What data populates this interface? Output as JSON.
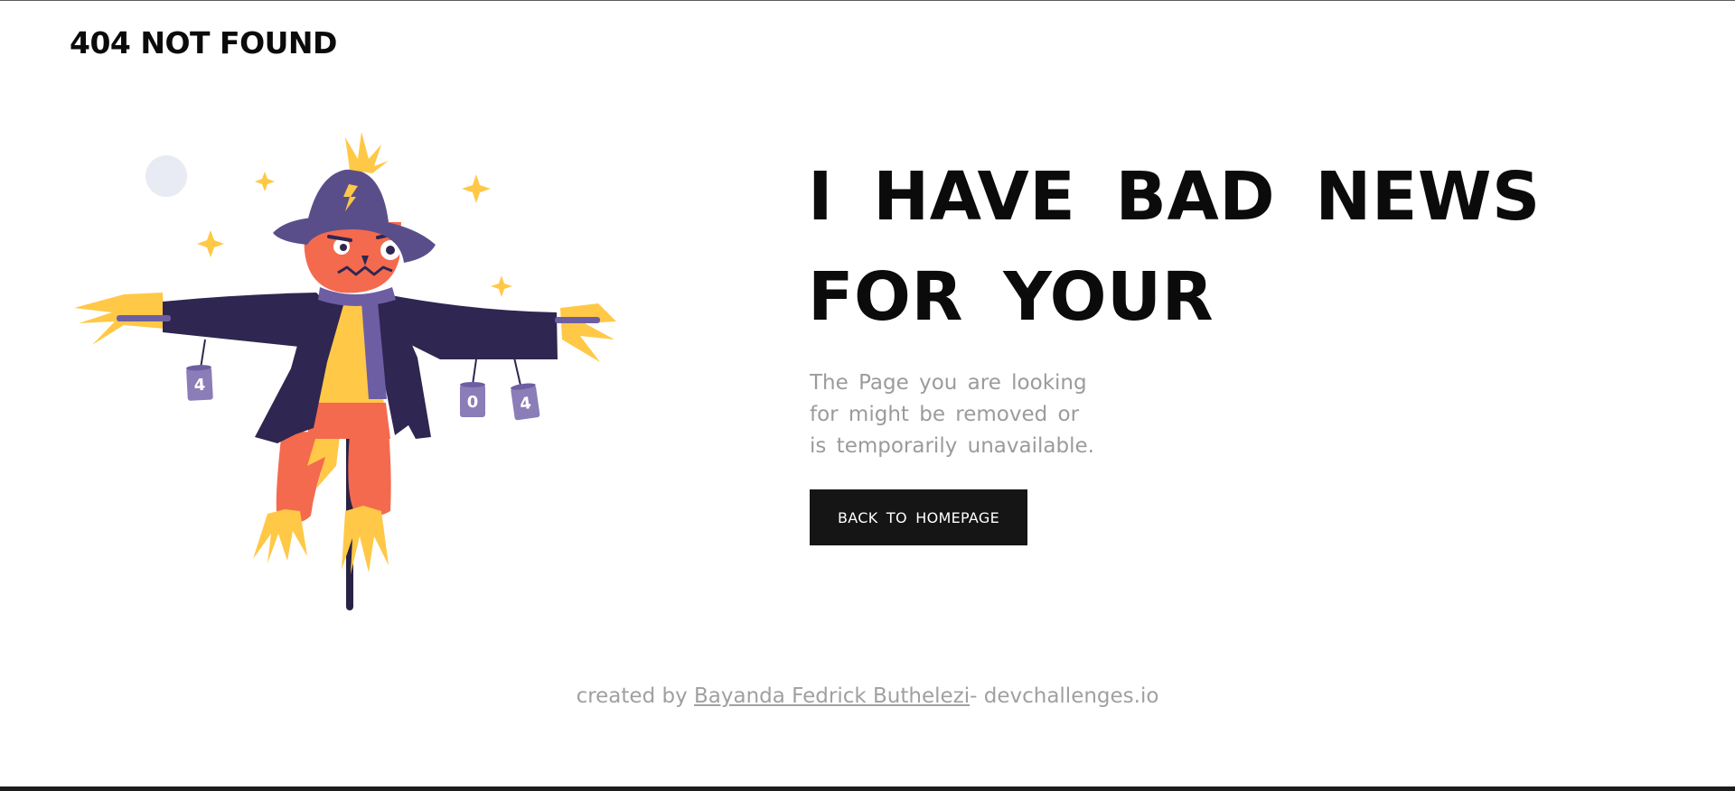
{
  "header": {
    "logo_text": "404 NOT FOUND"
  },
  "illustration": {
    "alt": "scarecrow",
    "can_labels": [
      "4",
      "0",
      "4"
    ],
    "colors": {
      "hat": "#5a4e8a",
      "face": "#f46a4e",
      "coat": "#2f2651",
      "straw": "#ffc846",
      "scarf": "#6d5ea3",
      "pole": "#2a2245",
      "can": "#8a7db8",
      "moon": "#e8ebf4"
    }
  },
  "main": {
    "headline_lines": [
      "I HAVE BAD NEWS",
      "FOR YOUR"
    ],
    "message_lines": [
      "The Page you are looking",
      "for might be removed or",
      "is temporarily unavailable."
    ],
    "button_label": "BACK TO HOMEPAGE"
  },
  "footer": {
    "prefix": "created by ",
    "author_link": "Bayanda Fedrick Buthelezi",
    "suffix": "- devchallenges.io"
  }
}
